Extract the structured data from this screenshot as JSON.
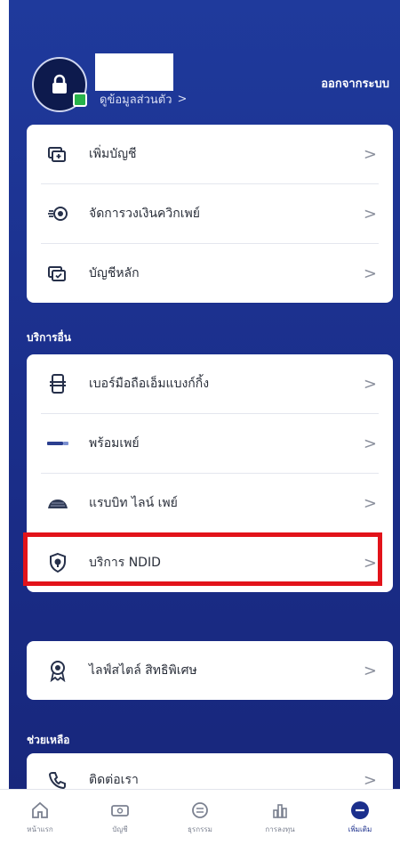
{
  "header": {
    "profile_link": "ดูข้อมูลส่วนตัว",
    "logout_label": "ออกจากระบบ"
  },
  "account_card": {
    "items": [
      {
        "label": "เพิ่มบัญชี",
        "icon": "add-account-icon"
      },
      {
        "label": "จัดการวงเงินควิกเพย์",
        "icon": "quickpay-limit-icon"
      },
      {
        "label": "บัญชีหลัก",
        "icon": "main-account-icon"
      }
    ]
  },
  "other_services": {
    "title": "บริการอื่น",
    "items": [
      {
        "label": "เบอร์มือถือเอ็มแบงก์กิ้ง",
        "icon": "mobile-banking-icon"
      },
      {
        "label": "พร้อมเพย์",
        "icon": "promptpay-icon"
      },
      {
        "label": "แรบบิท ไลน์ เพย์",
        "icon": "rabbit-line-pay-icon"
      },
      {
        "label": "บริการ NDID",
        "icon": "ndid-shield-icon"
      }
    ]
  },
  "lifestyle": {
    "items": [
      {
        "label": "ไลฟ์สไตล์ สิทธิพิเศษ",
        "icon": "privilege-award-icon"
      }
    ]
  },
  "help": {
    "title": "ช่วยเหลือ",
    "items": [
      {
        "label": "ติดต่อเรา",
        "icon": "contact-phone-icon"
      }
    ]
  },
  "bottom_nav": [
    {
      "label": "หน้าแรก",
      "icon": "home-icon"
    },
    {
      "label": "บัญชี",
      "icon": "account-icon"
    },
    {
      "label": "ธุรกรรม",
      "icon": "transaction-icon"
    },
    {
      "label": "การลงทุน",
      "icon": "investment-icon"
    },
    {
      "label": "เพิ่มเติม",
      "icon": "more-icon",
      "active": true
    }
  ],
  "colors": {
    "brand_blue": "#1b2f8c",
    "highlight_red": "#e2131a"
  }
}
